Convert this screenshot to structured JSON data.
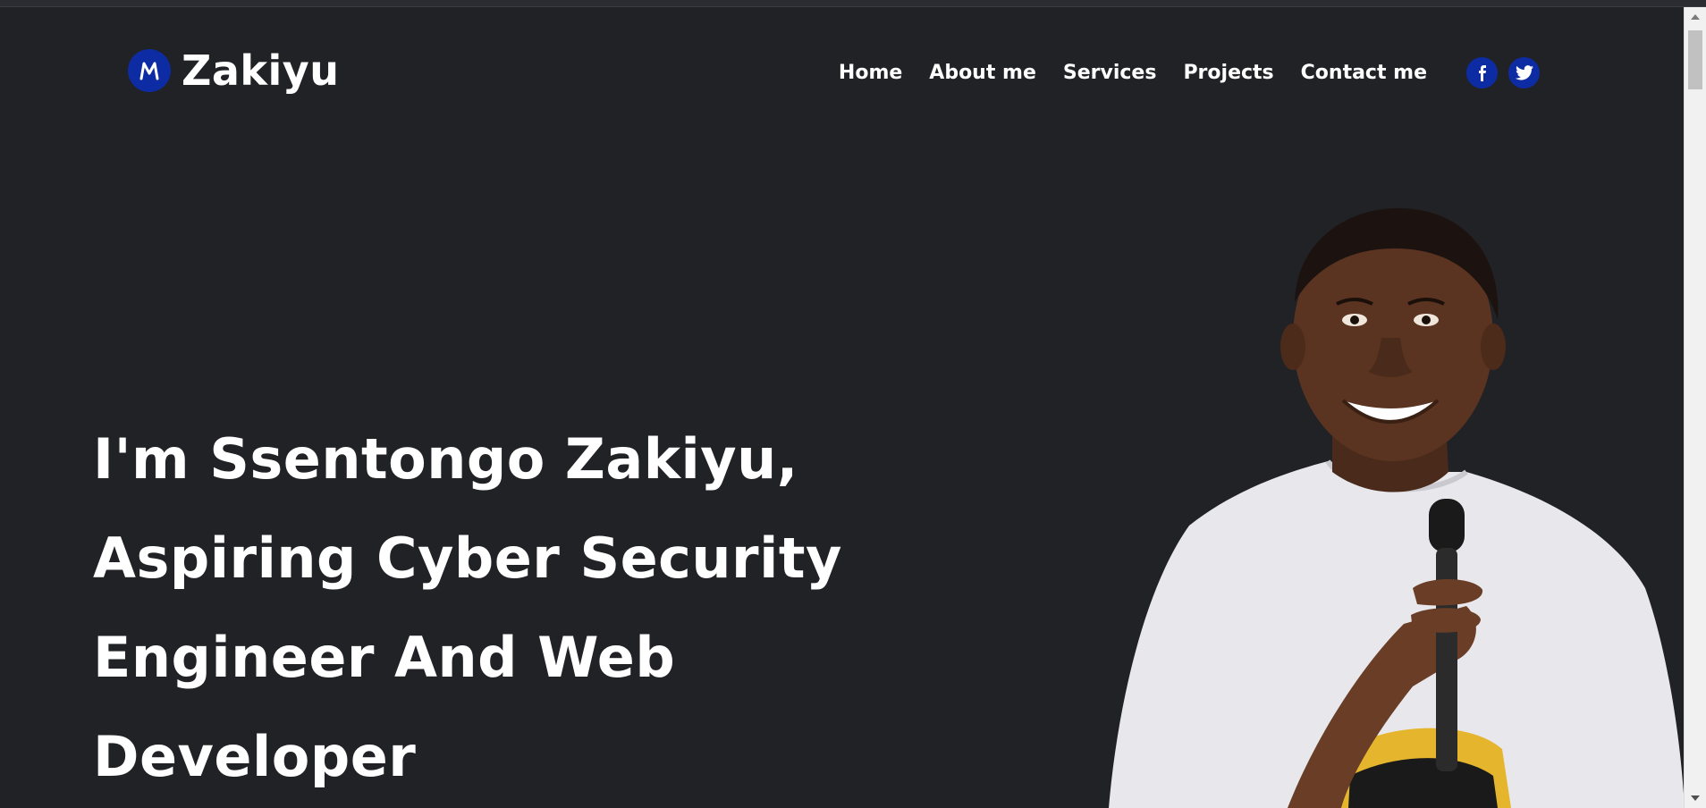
{
  "brand": {
    "logo_letter": "M",
    "name": "Zakiyu"
  },
  "nav": {
    "items": [
      {
        "label": "Home"
      },
      {
        "label": "About me"
      },
      {
        "label": "Services"
      },
      {
        "label": "Projects"
      },
      {
        "label": "Contact me"
      }
    ],
    "social": [
      {
        "icon": "facebook-icon",
        "glyph": "f"
      },
      {
        "icon": "twitter-icon"
      }
    ]
  },
  "hero": {
    "lines": [
      "I'm Ssentongo Zakiyu,",
      "Aspiring Cyber Security",
      "Engineer And Web",
      "Developer"
    ]
  },
  "colors": {
    "background": "#212226",
    "accent": "#0d2ca3",
    "text": "#ffffff"
  }
}
